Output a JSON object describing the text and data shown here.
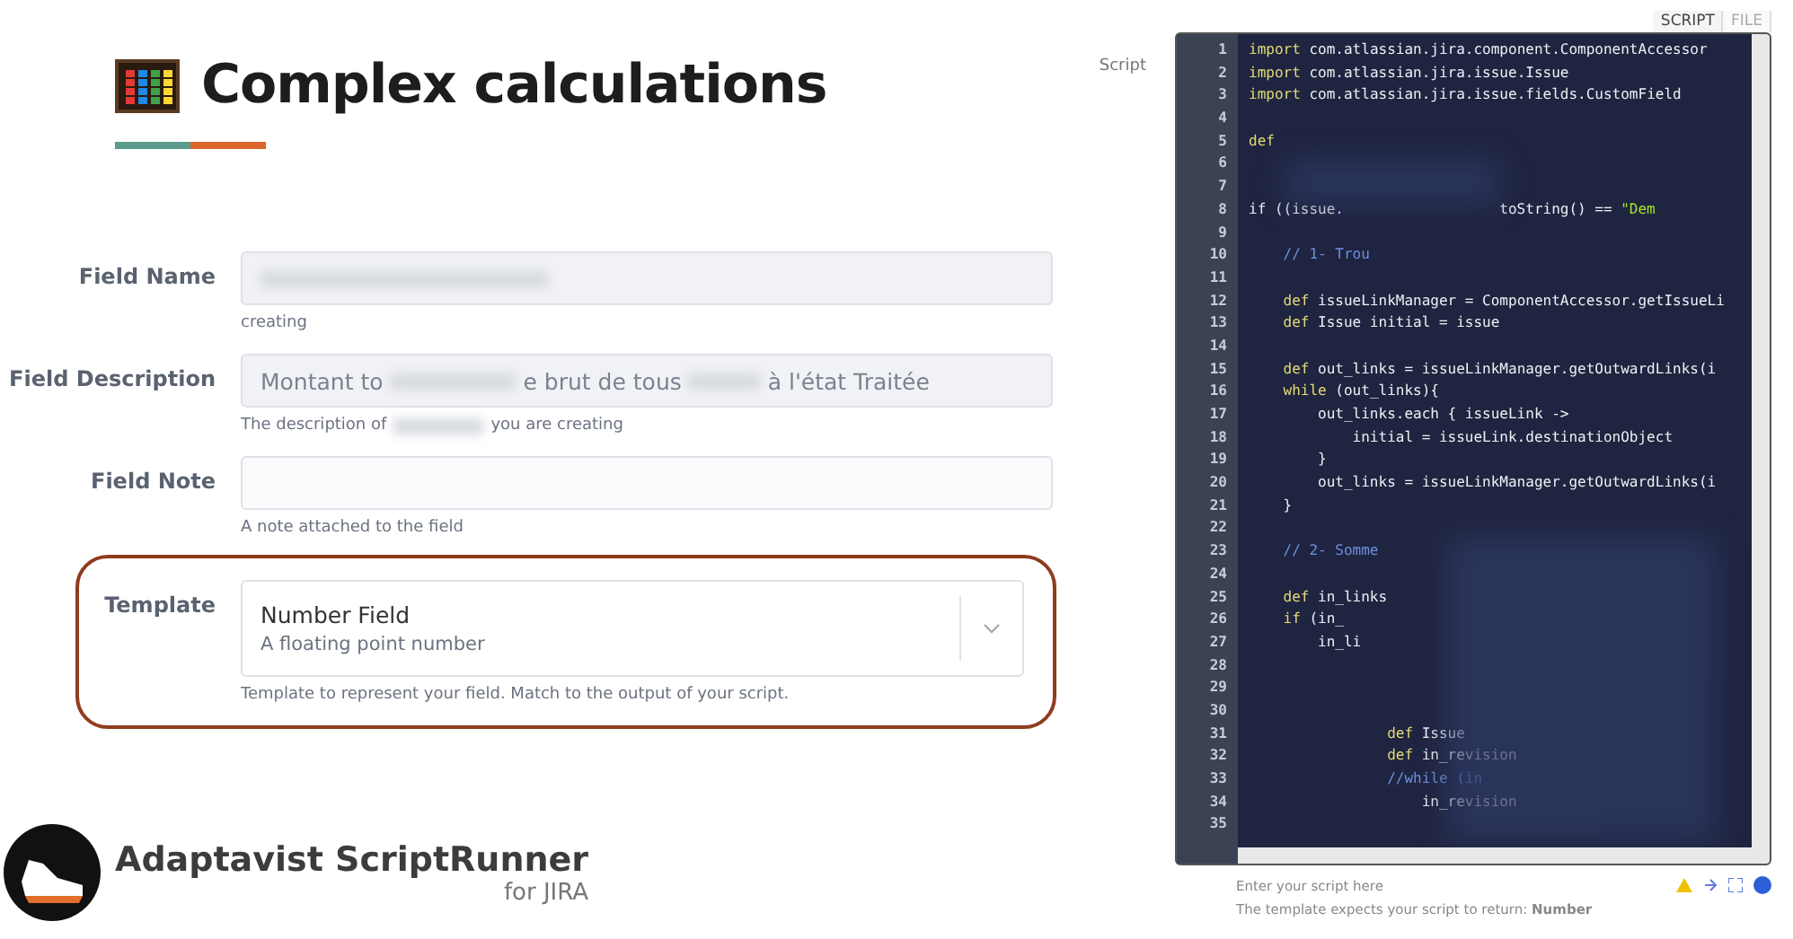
{
  "title": "Complex calculations",
  "form": {
    "fields": [
      {
        "label": "Field Name",
        "kind": "text",
        "help_parts": [
          "creating"
        ]
      },
      {
        "label": "Field Description",
        "kind": "text",
        "value_parts": [
          "Montant to",
          "e brut de tous",
          "à l'état Traitée"
        ],
        "help_parts": [
          "The description of",
          "you are creating"
        ]
      },
      {
        "label": "Field Note",
        "kind": "text",
        "help_parts": [
          "A note attached to the field"
        ]
      },
      {
        "label": "Template",
        "kind": "select",
        "value": "Number Field",
        "subtext": "A floating point number",
        "highlighted": true,
        "help_parts": [
          "Template to represent your field. Match to the output of your script."
        ]
      }
    ]
  },
  "script": {
    "label": "Script",
    "tabs": [
      {
        "label": "SCRIPT",
        "selected": true
      },
      {
        "label": "FILE",
        "selected": false
      }
    ],
    "lines": [
      {
        "n": "1",
        "kw": "import",
        "code": " com.atlassian.jira.component.ComponentAccessor"
      },
      {
        "n": "2",
        "kw": "import",
        "code": " com.atlassian.jira.issue.Issue"
      },
      {
        "n": "3",
        "kw": "import",
        "code": " com.atlassian.jira.issue.fields.CustomField"
      },
      {
        "n": "4"
      },
      {
        "n": "5",
        "kw": "def"
      },
      {
        "n": "6"
      },
      {
        "n": "7"
      },
      {
        "n": "8",
        "code": "if ((issue.",
        "code2": "toString() == ",
        "str": "\"Dem"
      },
      {
        "n": "9"
      },
      {
        "n": "10",
        "comment": "    // 1- Trou"
      },
      {
        "n": "11"
      },
      {
        "n": "12",
        "kw": "    def",
        "code": " issueLinkManager = ComponentAccessor.getIssueLi"
      },
      {
        "n": "13",
        "kw": "    def",
        "code": " Issue initial = issue"
      },
      {
        "n": "14"
      },
      {
        "n": "15",
        "kw": "    def",
        "code": " out_links = issueLinkManager.getOutwardLinks(i"
      },
      {
        "n": "16",
        "kw": "    while",
        "code": " (out_links){"
      },
      {
        "n": "17",
        "code": "        out_links.each { issueLink ->"
      },
      {
        "n": "18",
        "code": "            initial = issueLink.destinationObject"
      },
      {
        "n": "19",
        "code": "        }"
      },
      {
        "n": "20",
        "code": "        out_links = issueLinkManager.getOutwardLinks(i"
      },
      {
        "n": "21",
        "code": "    }"
      },
      {
        "n": "22"
      },
      {
        "n": "23",
        "comment": "    // 2- Somme"
      },
      {
        "n": "24"
      },
      {
        "n": "25",
        "kw": "    def",
        "code": " in_links"
      },
      {
        "n": "26",
        "kw": "    if",
        "code": " (in_"
      },
      {
        "n": "27",
        "code": "        in_li"
      },
      {
        "n": "28"
      },
      {
        "n": "29"
      },
      {
        "n": "30"
      },
      {
        "n": "31",
        "kw": "                def",
        "code": " Issue"
      },
      {
        "n": "32",
        "kw": "                def",
        "code": " in_revision"
      },
      {
        "n": "33",
        "comment": "                //while (in"
      },
      {
        "n": "34",
        "code": "                    in_revision"
      },
      {
        "n": "35"
      }
    ],
    "hint": "Enter your script here",
    "return_note": "The template expects your script to return: **Number**"
  },
  "brand": {
    "name": "Adaptavist ScriptRunner",
    "sub": "for JIRA"
  }
}
